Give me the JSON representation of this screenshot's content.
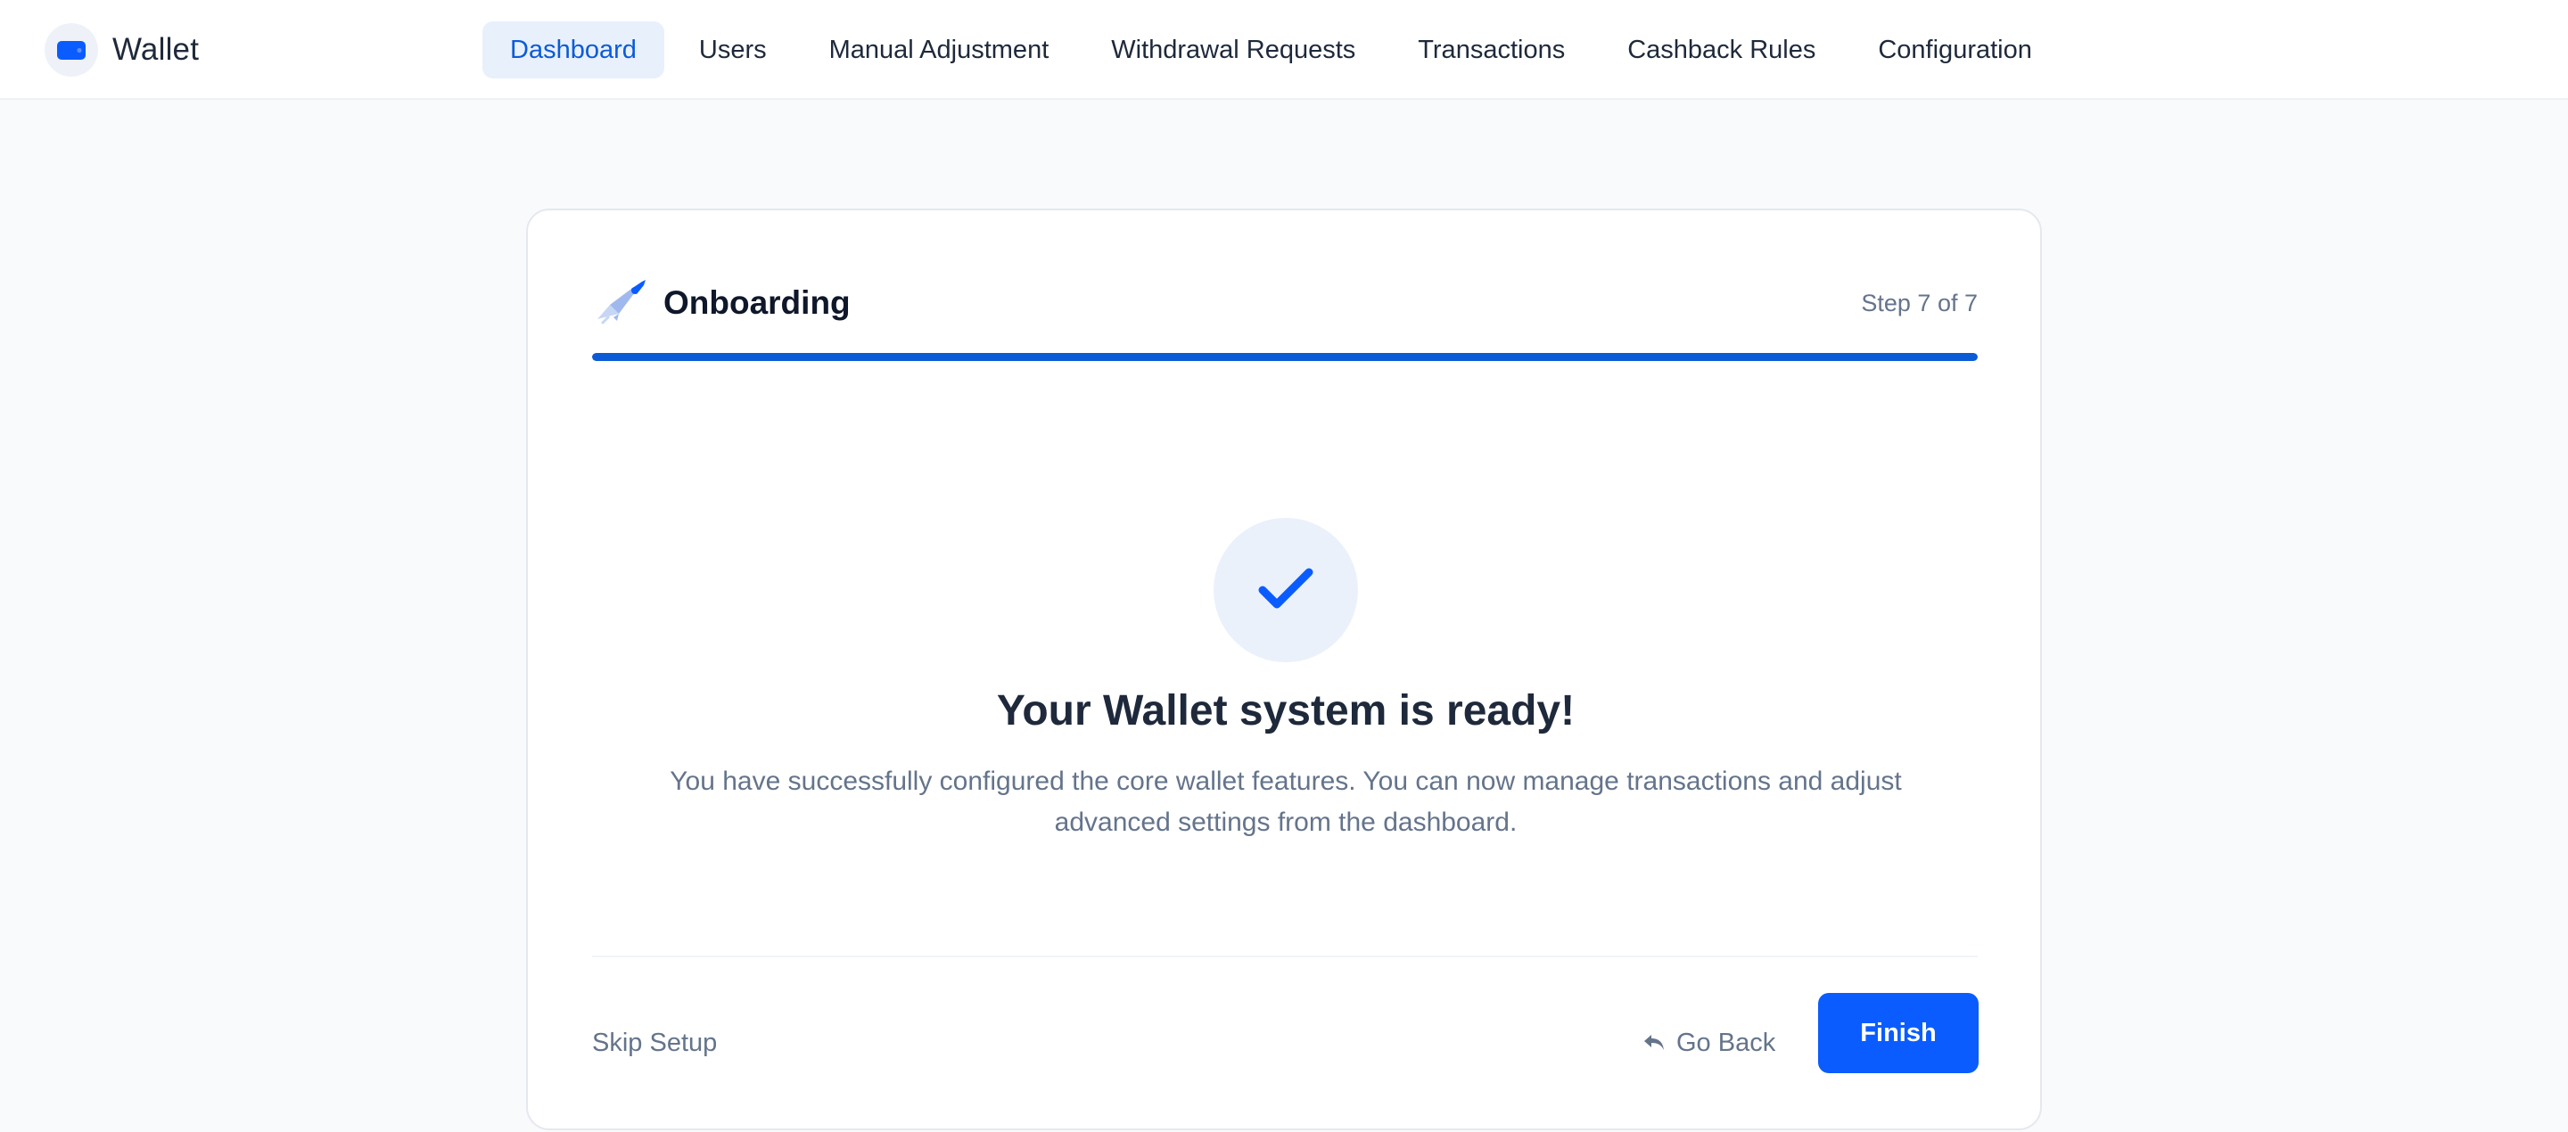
{
  "app": {
    "name": "Wallet",
    "logo_icon": "wallet-icon",
    "accent_color": "#0a5cff"
  },
  "nav": {
    "items": [
      {
        "label": "Dashboard",
        "active": true
      },
      {
        "label": "Users",
        "active": false
      },
      {
        "label": "Manual Adjustment",
        "active": false
      },
      {
        "label": "Withdrawal Requests",
        "active": false
      },
      {
        "label": "Transactions",
        "active": false
      },
      {
        "label": "Cashback Rules",
        "active": false
      },
      {
        "label": "Configuration",
        "active": false
      }
    ]
  },
  "onboarding": {
    "title": "Onboarding",
    "title_icon": "rocket-icon",
    "step_label": "Step 7 of 7",
    "progress_percent": 100,
    "success_icon": "checkmark-icon",
    "headline": "Your Wallet system is ready!",
    "description": "You have successfully configured the core wallet features. You can now manage transactions and adjust advanced settings from the dashboard.",
    "skip_label": "Skip Setup",
    "back_label": "Go Back",
    "back_icon": "reply-arrow-icon",
    "finish_label": "Finish"
  }
}
